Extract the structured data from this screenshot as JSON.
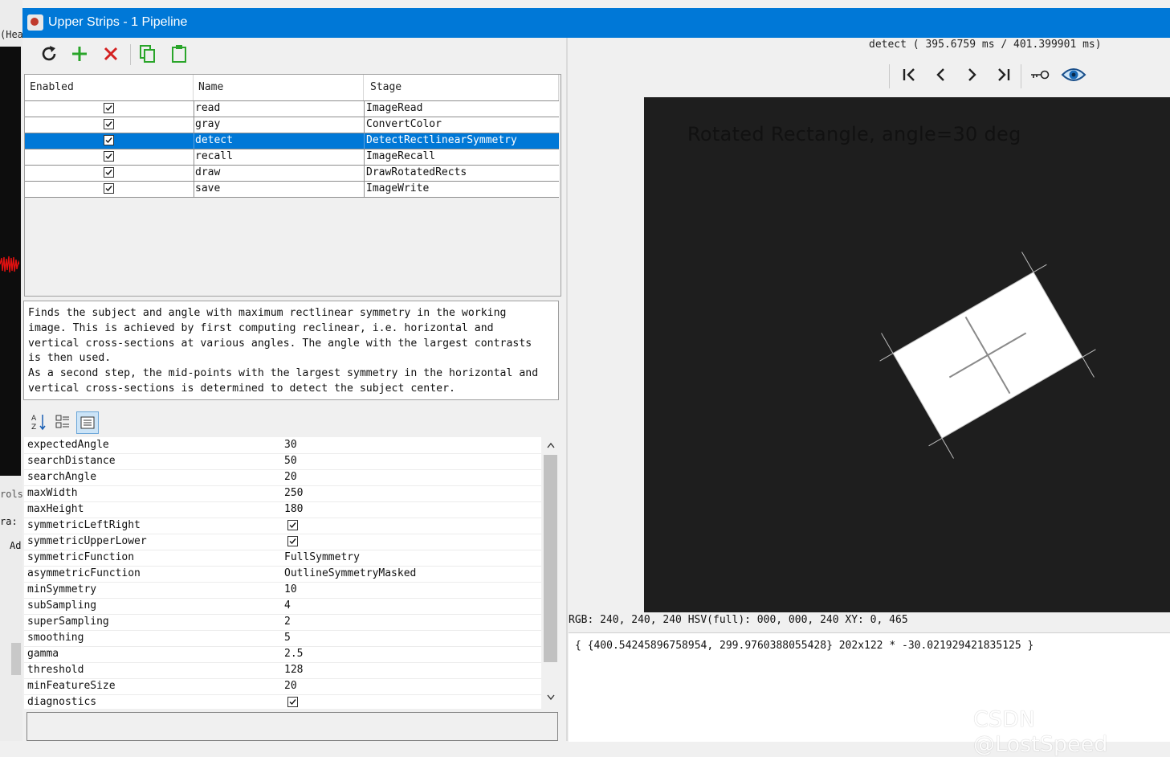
{
  "window": {
    "title": "Upper Strips - 1 Pipeline"
  },
  "background": {
    "label_top": "(Hea",
    "label_controls": "rols",
    "label_ra": "ra:",
    "label_ad": "Ad"
  },
  "toolbar": {
    "buttons": [
      {
        "icon": "refresh-icon",
        "color": "#222222"
      },
      {
        "icon": "add-icon",
        "color": "#2aa52a"
      },
      {
        "icon": "delete-icon",
        "color": "#d42020"
      },
      {
        "icon": "copy-icon",
        "color": "#2aa52a"
      },
      {
        "icon": "paste-icon",
        "color": "#2aa52a"
      }
    ]
  },
  "stages": {
    "headers": {
      "enabled": "Enabled",
      "name": "Name",
      "stage": "Stage"
    },
    "rows": [
      {
        "enabled": true,
        "name": "read",
        "stage": "ImageRead",
        "selected": false
      },
      {
        "enabled": true,
        "name": "gray",
        "stage": "ConvertColor",
        "selected": false
      },
      {
        "enabled": true,
        "name": "detect",
        "stage": "DetectRectlinearSymmetry",
        "selected": true
      },
      {
        "enabled": true,
        "name": "recall",
        "stage": "ImageRecall",
        "selected": false
      },
      {
        "enabled": true,
        "name": "draw",
        "stage": "DrawRotatedRects",
        "selected": false
      },
      {
        "enabled": true,
        "name": "save",
        "stage": "ImageWrite",
        "selected": false
      }
    ]
  },
  "description": {
    "text": "Finds the subject and angle with maximum rectlinear symmetry in the working\nimage. This is achieved by first computing reclinear, i.e. horizontal and\nvertical cross-sections at various angles. The angle with the largest contrasts\nis then used.\nAs a second step, the mid-points with the largest symmetry in the horizontal and\nvertical cross-sections is determined to detect the subject center."
  },
  "properties": {
    "toolbar_icons": [
      "sort-alpha-icon",
      "categorized-icon",
      "property-pages-icon"
    ],
    "items": [
      {
        "name": "expectedAngle",
        "value": "30"
      },
      {
        "name": "searchDistance",
        "value": "50"
      },
      {
        "name": "searchAngle",
        "value": "20"
      },
      {
        "name": "maxWidth",
        "value": "250"
      },
      {
        "name": "maxHeight",
        "value": "180"
      },
      {
        "name": "symmetricLeftRight",
        "checked": true
      },
      {
        "name": "symmetricUpperLower",
        "checked": true
      },
      {
        "name": "symmetricFunction",
        "value": "FullSymmetry"
      },
      {
        "name": "asymmetricFunction",
        "value": "OutlineSymmetryMasked"
      },
      {
        "name": "minSymmetry",
        "value": "10"
      },
      {
        "name": "subSampling",
        "value": "4"
      },
      {
        "name": "superSampling",
        "value": "2"
      },
      {
        "name": "smoothing",
        "value": "5"
      },
      {
        "name": "gamma",
        "value": "2.5"
      },
      {
        "name": "threshold",
        "value": "128"
      },
      {
        "name": "minFeatureSize",
        "value": "20"
      },
      {
        "name": "diagnostics",
        "checked": true
      }
    ]
  },
  "viewer": {
    "timing": "detect ( 395.6759 ms / 401.399901 ms)",
    "nav_icons": [
      "first-icon",
      "previous-icon",
      "next-icon",
      "last-icon",
      "key-icon",
      "eye-icon"
    ],
    "image_caption": "Rotated Rectangle, angle=30 deg",
    "pixel_info": "RGB: 240, 240, 240 HSV(full): 000, 000, 240 XY: 0, 465",
    "result": "{ {400.54245896758954, 299.9760388055428} 202x122 * -30.021929421835125 }"
  },
  "watermark": "CSDN @LostSpeed"
}
